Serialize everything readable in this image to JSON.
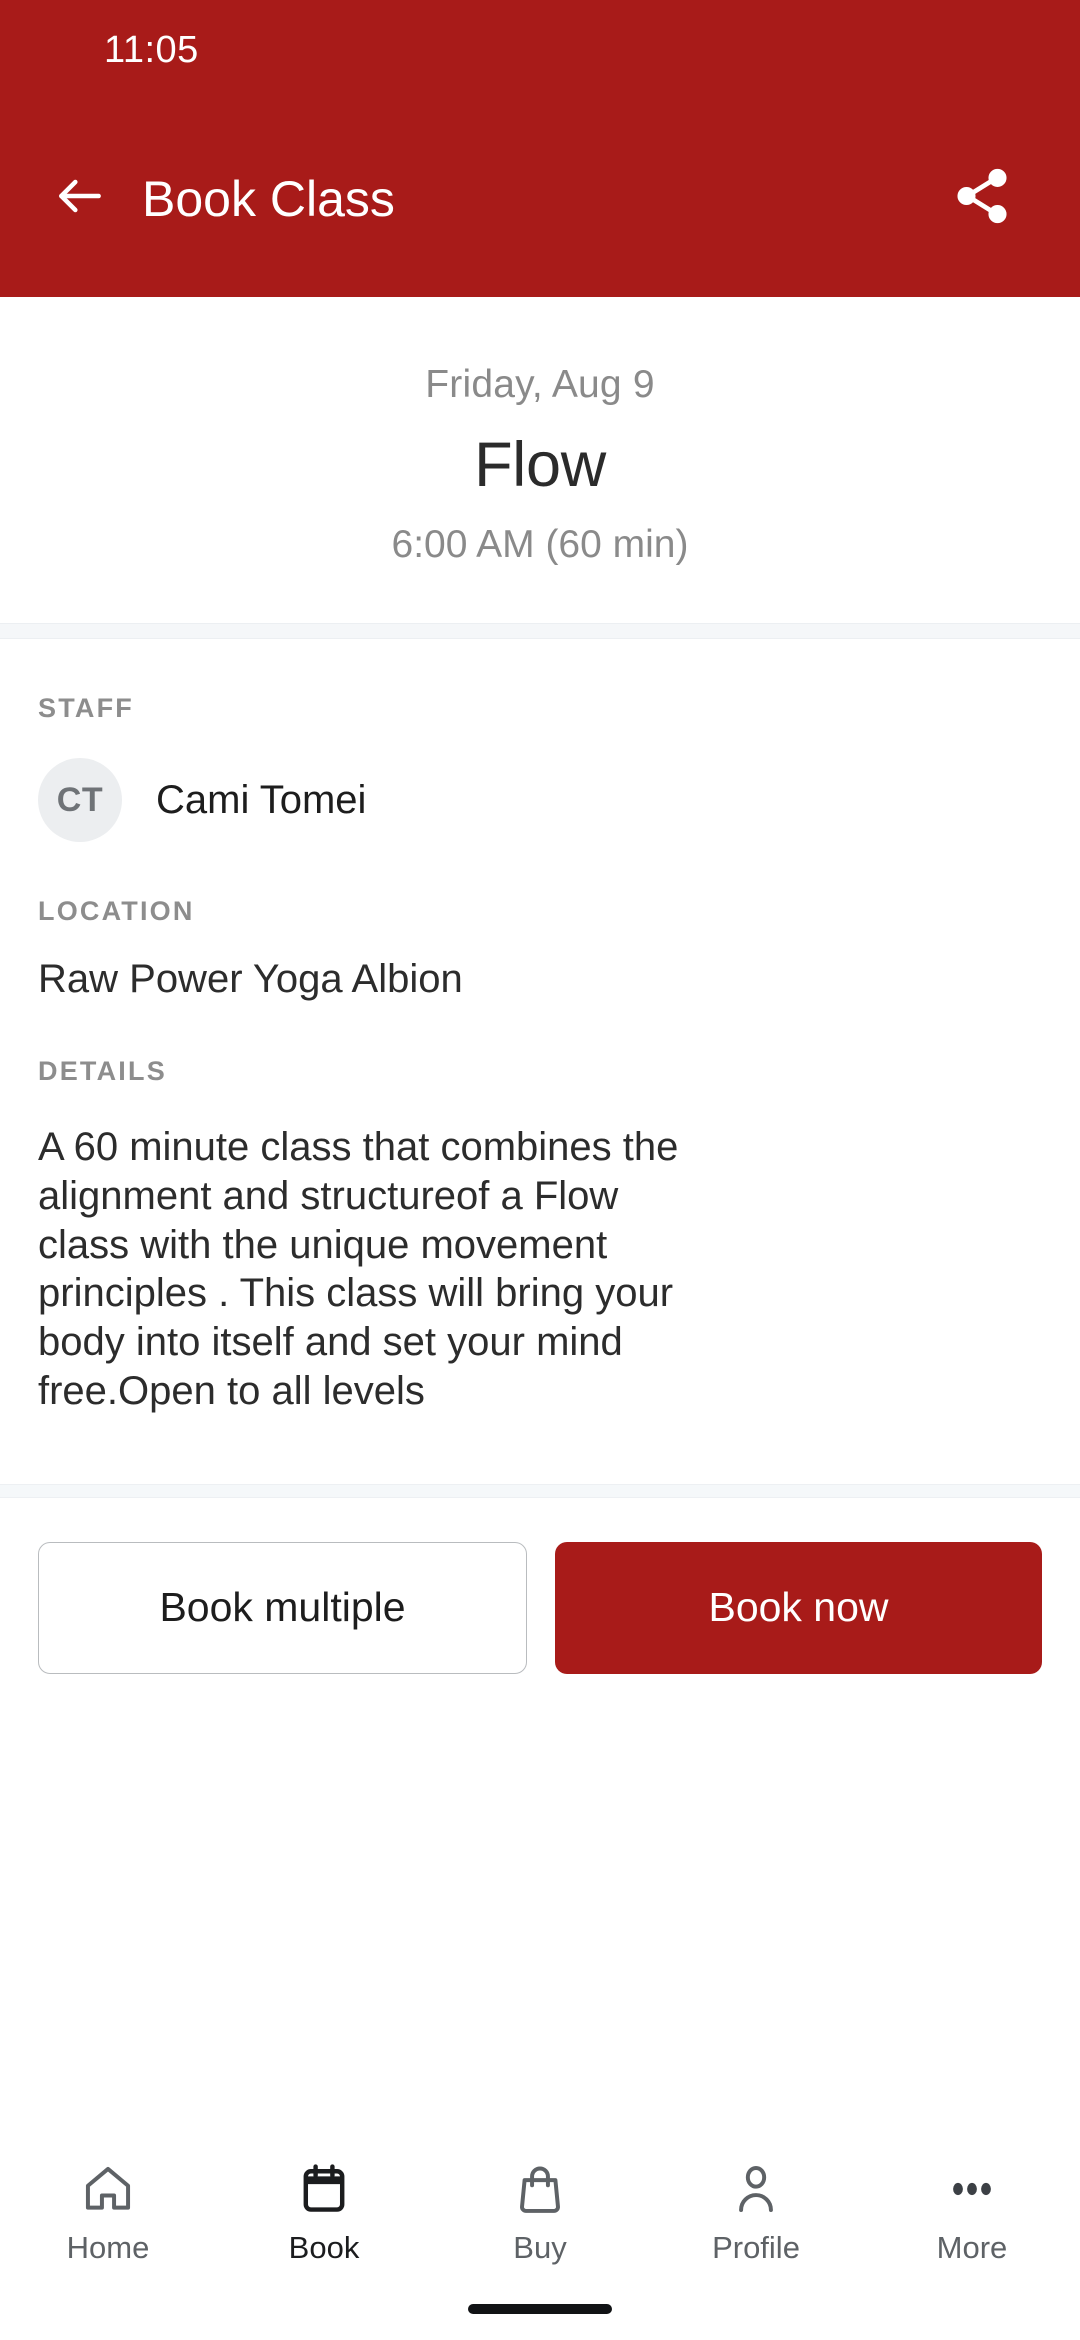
{
  "status_bar": {
    "time": "11:05"
  },
  "app_bar": {
    "title": "Book Class",
    "back_icon": "arrow-left-icon",
    "share_icon": "share-icon",
    "background_color": "#A81B19"
  },
  "summary": {
    "date": "Friday, Aug 9",
    "class_name": "Flow",
    "time": "6:00 AM (60 min)"
  },
  "staff": {
    "label": "STAFF",
    "avatar_initials": "CT",
    "name": "Cami Tomei"
  },
  "location": {
    "label": "LOCATION",
    "value": "Raw Power Yoga Albion"
  },
  "details": {
    "label": "DETAILS",
    "text": "A 60 minute class that combines the alignment and structureof a Flow class with the unique movement principles . This class will bring your body into itself and set your mind free.Open to all levels"
  },
  "actions": {
    "book_multiple_label": "Book multiple",
    "book_now_label": "Book now",
    "primary_color": "#A81B19"
  },
  "bottom_nav": {
    "items": [
      {
        "label": "Home",
        "icon": "home-icon",
        "active": false
      },
      {
        "label": "Book",
        "icon": "calendar-icon",
        "active": true
      },
      {
        "label": "Buy",
        "icon": "shopping-bag-icon",
        "active": false
      },
      {
        "label": "Profile",
        "icon": "person-icon",
        "active": false
      },
      {
        "label": "More",
        "icon": "ellipsis-icon",
        "active": false
      }
    ]
  }
}
